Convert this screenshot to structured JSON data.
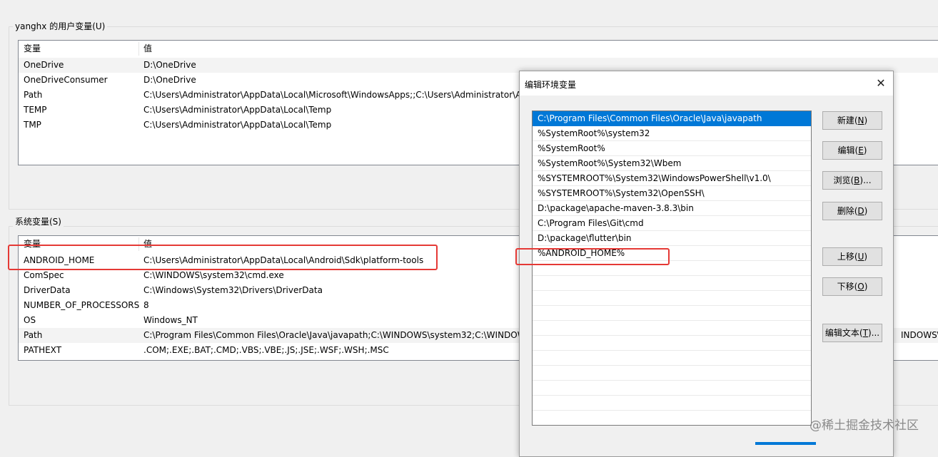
{
  "user_vars": {
    "legend": "yanghx 的用户变量(U)",
    "headers": {
      "var": "变量",
      "val": "值"
    },
    "rows": [
      {
        "var": "OneDrive",
        "val": "D:\\OneDrive"
      },
      {
        "var": "OneDriveConsumer",
        "val": "D:\\OneDrive"
      },
      {
        "var": "Path",
        "val": "C:\\Users\\Administrator\\AppData\\Local\\Microsoft\\WindowsApps;;C:\\Users\\Administrator\\A"
      },
      {
        "var": "TEMP",
        "val": "C:\\Users\\Administrator\\AppData\\Local\\Temp"
      },
      {
        "var": "TMP",
        "val": "C:\\Users\\Administrator\\AppData\\Local\\Temp"
      }
    ]
  },
  "system_vars": {
    "legend": "系统变量(S)",
    "headers": {
      "var": "变量",
      "val": "值"
    },
    "rows": [
      {
        "var": "ANDROID_HOME",
        "val": "C:\\Users\\Administrator\\AppData\\Local\\Android\\Sdk\\platform-tools"
      },
      {
        "var": "ComSpec",
        "val": "C:\\WINDOWS\\system32\\cmd.exe"
      },
      {
        "var": "DriverData",
        "val": "C:\\Windows\\System32\\Drivers\\DriverData"
      },
      {
        "var": "NUMBER_OF_PROCESSORS",
        "val": "8"
      },
      {
        "var": "OS",
        "val": "Windows_NT"
      },
      {
        "var": "Path",
        "val": "C:\\Program Files\\Common Files\\Oracle\\Java\\javapath;C:\\WINDOWS\\system32;C:\\WINDOW"
      },
      {
        "var": "PATHEXT",
        "val": ".COM;.EXE;.BAT;.CMD;.VBS;.VBE;.JS;.JSE;.WSF;.WSH;.MSC"
      }
    ],
    "path_overflow_tail": "INDOWS\\S"
  },
  "dialog": {
    "title": "编辑环境变量",
    "close_glyph": "✕",
    "paths": [
      "C:\\Program Files\\Common Files\\Oracle\\Java\\javapath",
      "%SystemRoot%\\system32",
      "%SystemRoot%",
      "%SystemRoot%\\System32\\Wbem",
      "%SYSTEMROOT%\\System32\\WindowsPowerShell\\v1.0\\",
      "%SYSTEMROOT%\\System32\\OpenSSH\\",
      "D:\\package\\apache-maven-3.8.3\\bin",
      "C:\\Program Files\\Git\\cmd",
      "D:\\package\\flutter\\bin",
      "%ANDROID_HOME%"
    ],
    "selected_index": 0,
    "buttons": {
      "new": {
        "text": "新建(",
        "key": "N",
        "end": ")"
      },
      "edit": {
        "text": "编辑(",
        "key": "E",
        "end": ")"
      },
      "browse": {
        "text": "浏览(",
        "key": "B",
        "end": ")..."
      },
      "delete": {
        "text": "删除(",
        "key": "D",
        "end": ")"
      },
      "up": {
        "text": "上移(",
        "key": "U",
        "end": ")"
      },
      "down": {
        "text": "下移(",
        "key": "O",
        "end": ")"
      },
      "edit_text": {
        "text": "编辑文本(",
        "key": "T",
        "end": ")..."
      }
    }
  },
  "watermark": "@稀土掘金技术社区",
  "colors": {
    "selection": "#0078d7",
    "highlight_box": "#e53935"
  }
}
